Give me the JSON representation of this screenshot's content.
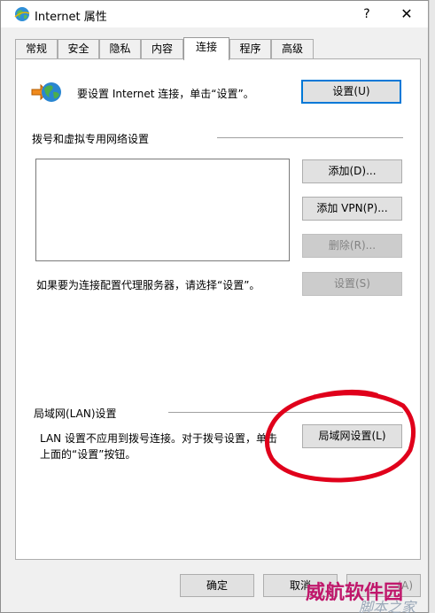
{
  "window": {
    "title": "Internet 属性",
    "help": "?",
    "close": "✕"
  },
  "tabs": [
    {
      "label": "常规"
    },
    {
      "label": "安全"
    },
    {
      "label": "隐私"
    },
    {
      "label": "内容"
    },
    {
      "label": "连接"
    },
    {
      "label": "程序"
    },
    {
      "label": "高级"
    }
  ],
  "setup": {
    "text": "要设置 Internet 连接，单击“设置”。",
    "button": "设置(U)"
  },
  "dialup": {
    "group_label": "拨号和虚拟专用网络设置",
    "add_button": "添加(D)...",
    "add_vpn_button": "添加 VPN(P)...",
    "remove_button": "删除(R)...",
    "settings_button": "设置(S)",
    "proxy_text": "如果要为连接配置代理服务器，请选择“设置”。"
  },
  "lan": {
    "group_label": "局域网(LAN)设置",
    "text_line1": "LAN 设置不应用到拨号连接。对于拨号设置，单击",
    "text_line2": "上面的“设置”按钮。",
    "button": "局域网设置(L)"
  },
  "footer": {
    "ok": "确定",
    "cancel": "取消",
    "apply_partial": "(A)"
  },
  "watermark": {
    "line1": "威航软件园",
    "line2": "脚本之家"
  },
  "colors": {
    "accent": "#0078d7",
    "annotation": "#e0001b"
  }
}
